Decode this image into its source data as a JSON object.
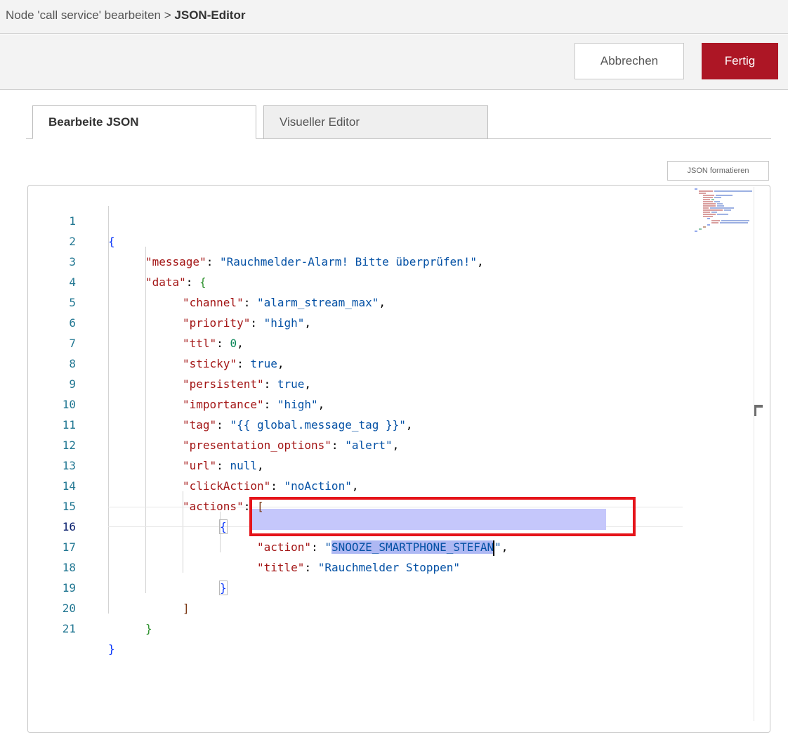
{
  "breadcrumb": {
    "parent": "Node 'call service' bearbeiten",
    "separator": ">",
    "current": "JSON-Editor"
  },
  "toolbar": {
    "cancel_label": "Abbrechen",
    "done_label": "Fertig"
  },
  "tabs": [
    {
      "label": "Bearbeite JSON",
      "active": true
    },
    {
      "label": "Visueller Editor",
      "active": false
    }
  ],
  "format_button": "JSON formatieren",
  "editor": {
    "line_numbers": [
      "1",
      "2",
      "3",
      "4",
      "5",
      "6",
      "7",
      "8",
      "9",
      "10",
      "11",
      "12",
      "13",
      "14",
      "15",
      "16",
      "17",
      "18",
      "19",
      "20",
      "21"
    ],
    "active_line": "16",
    "selected_text": "SNOOZE_SMARTPHONE_STEFAN",
    "lines": {
      "l1": {
        "t1": "{"
      },
      "l2": {
        "t1": "\"message\"",
        "t2": ": ",
        "t3": "\"Rauchmelder-Alarm! Bitte überprüfen!\"",
        "t4": ","
      },
      "l3": {
        "t1": "\"data\"",
        "t2": ": ",
        "t3": "{"
      },
      "l4": {
        "t1": "\"channel\"",
        "t2": ": ",
        "t3": "\"alarm_stream_max\"",
        "t4": ","
      },
      "l5": {
        "t1": "\"priority\"",
        "t2": ": ",
        "t3": "\"high\"",
        "t4": ","
      },
      "l6": {
        "t1": "\"ttl\"",
        "t2": ": ",
        "t3": "0",
        "t4": ","
      },
      "l7": {
        "t1": "\"sticky\"",
        "t2": ": ",
        "t3": "true",
        "t4": ","
      },
      "l8": {
        "t1": "\"persistent\"",
        "t2": ": ",
        "t3": "true",
        "t4": ","
      },
      "l9": {
        "t1": "\"importance\"",
        "t2": ": ",
        "t3": "\"high\"",
        "t4": ","
      },
      "l10": {
        "t1": "\"tag\"",
        "t2": ": ",
        "t3": "\"{{ global.message_tag }}\"",
        "t4": ","
      },
      "l11": {
        "t1": "\"presentation_options\"",
        "t2": ": ",
        "t3": "\"alert\"",
        "t4": ","
      },
      "l12": {
        "t1": "\"url\"",
        "t2": ": ",
        "t3": "null",
        "t4": ","
      },
      "l13": {
        "t1": "\"clickAction\"",
        "t2": ": ",
        "t3": "\"noAction\"",
        "t4": ","
      },
      "l14": {
        "t1": "\"actions\"",
        "t2": ": ",
        "t3": "["
      },
      "l15": {
        "t1": "{"
      },
      "l16": {
        "t1": "\"action\"",
        "t2": ": ",
        "t3a": "\"",
        "t3b": "SNOOZE_SMARTPHONE_STEFAN",
        "t3c": "\"",
        "t4": ","
      },
      "l17": {
        "t1": "\"title\"",
        "t2": ": ",
        "t3": "\"Rauchmelder Stoppen\""
      },
      "l18": {
        "t1": "}"
      },
      "l19": {
        "t1": "]"
      },
      "l20": {
        "t1": "}"
      },
      "l21": {
        "t1": "}"
      }
    }
  },
  "colors": {
    "accent": "#ad1625",
    "highlight_box": "#e5141a",
    "json_key": "#a31515",
    "json_string": "#0451a5",
    "json_number": "#098658",
    "selection": "#aeb8f3"
  }
}
